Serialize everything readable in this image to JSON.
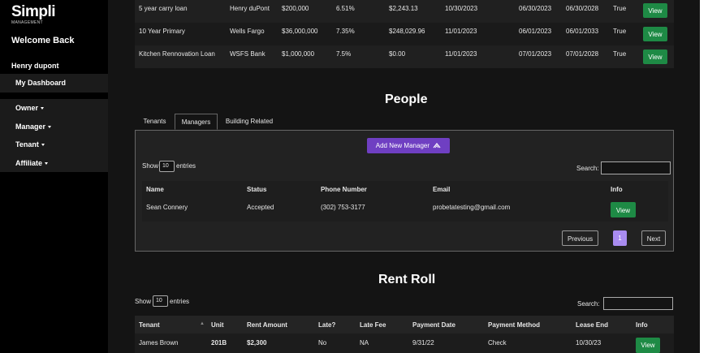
{
  "sidebar": {
    "logo": "Simpli",
    "logo_sub": "MANAGEMENT",
    "welcome": "Welcome Back",
    "username": "Henry dupont",
    "dashboard": "My Dashboard",
    "menu": [
      "Owner",
      "Manager",
      "Tenant",
      "Affiliate"
    ]
  },
  "loans": {
    "rows": [
      {
        "name": "5 year carry loan",
        "lender": "Henry duPont",
        "amount": "$200,000",
        "rate": "6.51%",
        "payment": "$2,243.13",
        "date1": "10/30/2023",
        "date2": "06/30/2023",
        "date3": "06/30/2028",
        "active": "True",
        "action": "View"
      },
      {
        "name": "10 Year Primary",
        "lender": "Wells Fargo",
        "amount": "$36,000,000",
        "rate": "7.35%",
        "payment": "$248,029.96",
        "date1": "11/01/2023",
        "date2": "06/01/2023",
        "date3": "06/01/2033",
        "active": "True",
        "action": "View"
      },
      {
        "name": "Kitchen Rennovation Loan",
        "lender": "WSFS Bank",
        "amount": "$1,000,000",
        "rate": "7.5%",
        "payment": "$0.00",
        "date1": "11/01/2023",
        "date2": "07/01/2023",
        "date3": "07/01/2028",
        "active": "True",
        "action": "View"
      }
    ]
  },
  "people": {
    "title": "People",
    "tabs": [
      "Tenants",
      "Managers",
      "Building Related"
    ],
    "add_button": "Add New Manager",
    "show_label": "Show",
    "entries_value": "10",
    "entries_label": "entries",
    "search_label": "Search:",
    "columns": [
      "Name",
      "Status",
      "Phone Number",
      "Email",
      "Info"
    ],
    "rows": [
      {
        "name": "Sean Connery",
        "status": "Accepted",
        "phone": "(302) 753-3177",
        "email": "probetatesting@gmail.com",
        "action": "View"
      }
    ],
    "pagination": {
      "previous": "Previous",
      "page": "1",
      "next": "Next"
    }
  },
  "rent_roll": {
    "title": "Rent Roll",
    "show_label": "Show",
    "entries_value": "10",
    "entries_label": "entries",
    "search_label": "Search:",
    "columns": [
      "Tenant",
      "Unit",
      "Rent Amount",
      "Late?",
      "Late Fee",
      "Payment Date",
      "Payment Method",
      "Lease End",
      "Info"
    ],
    "rows": [
      {
        "tenant": "James Brown",
        "unit": "201B",
        "rent": "$2,300",
        "late": "No",
        "fee": "NA",
        "pay_date": "9/31/22",
        "method": "Check",
        "lease_end": "10/30/23",
        "action": "View"
      }
    ]
  },
  "colors": {
    "view_button": "#1e8a45",
    "add_button": "#6f3fc2",
    "page_active": "#a98cf0",
    "sidebar_bg": "#000000",
    "main_bg": "#141414"
  }
}
